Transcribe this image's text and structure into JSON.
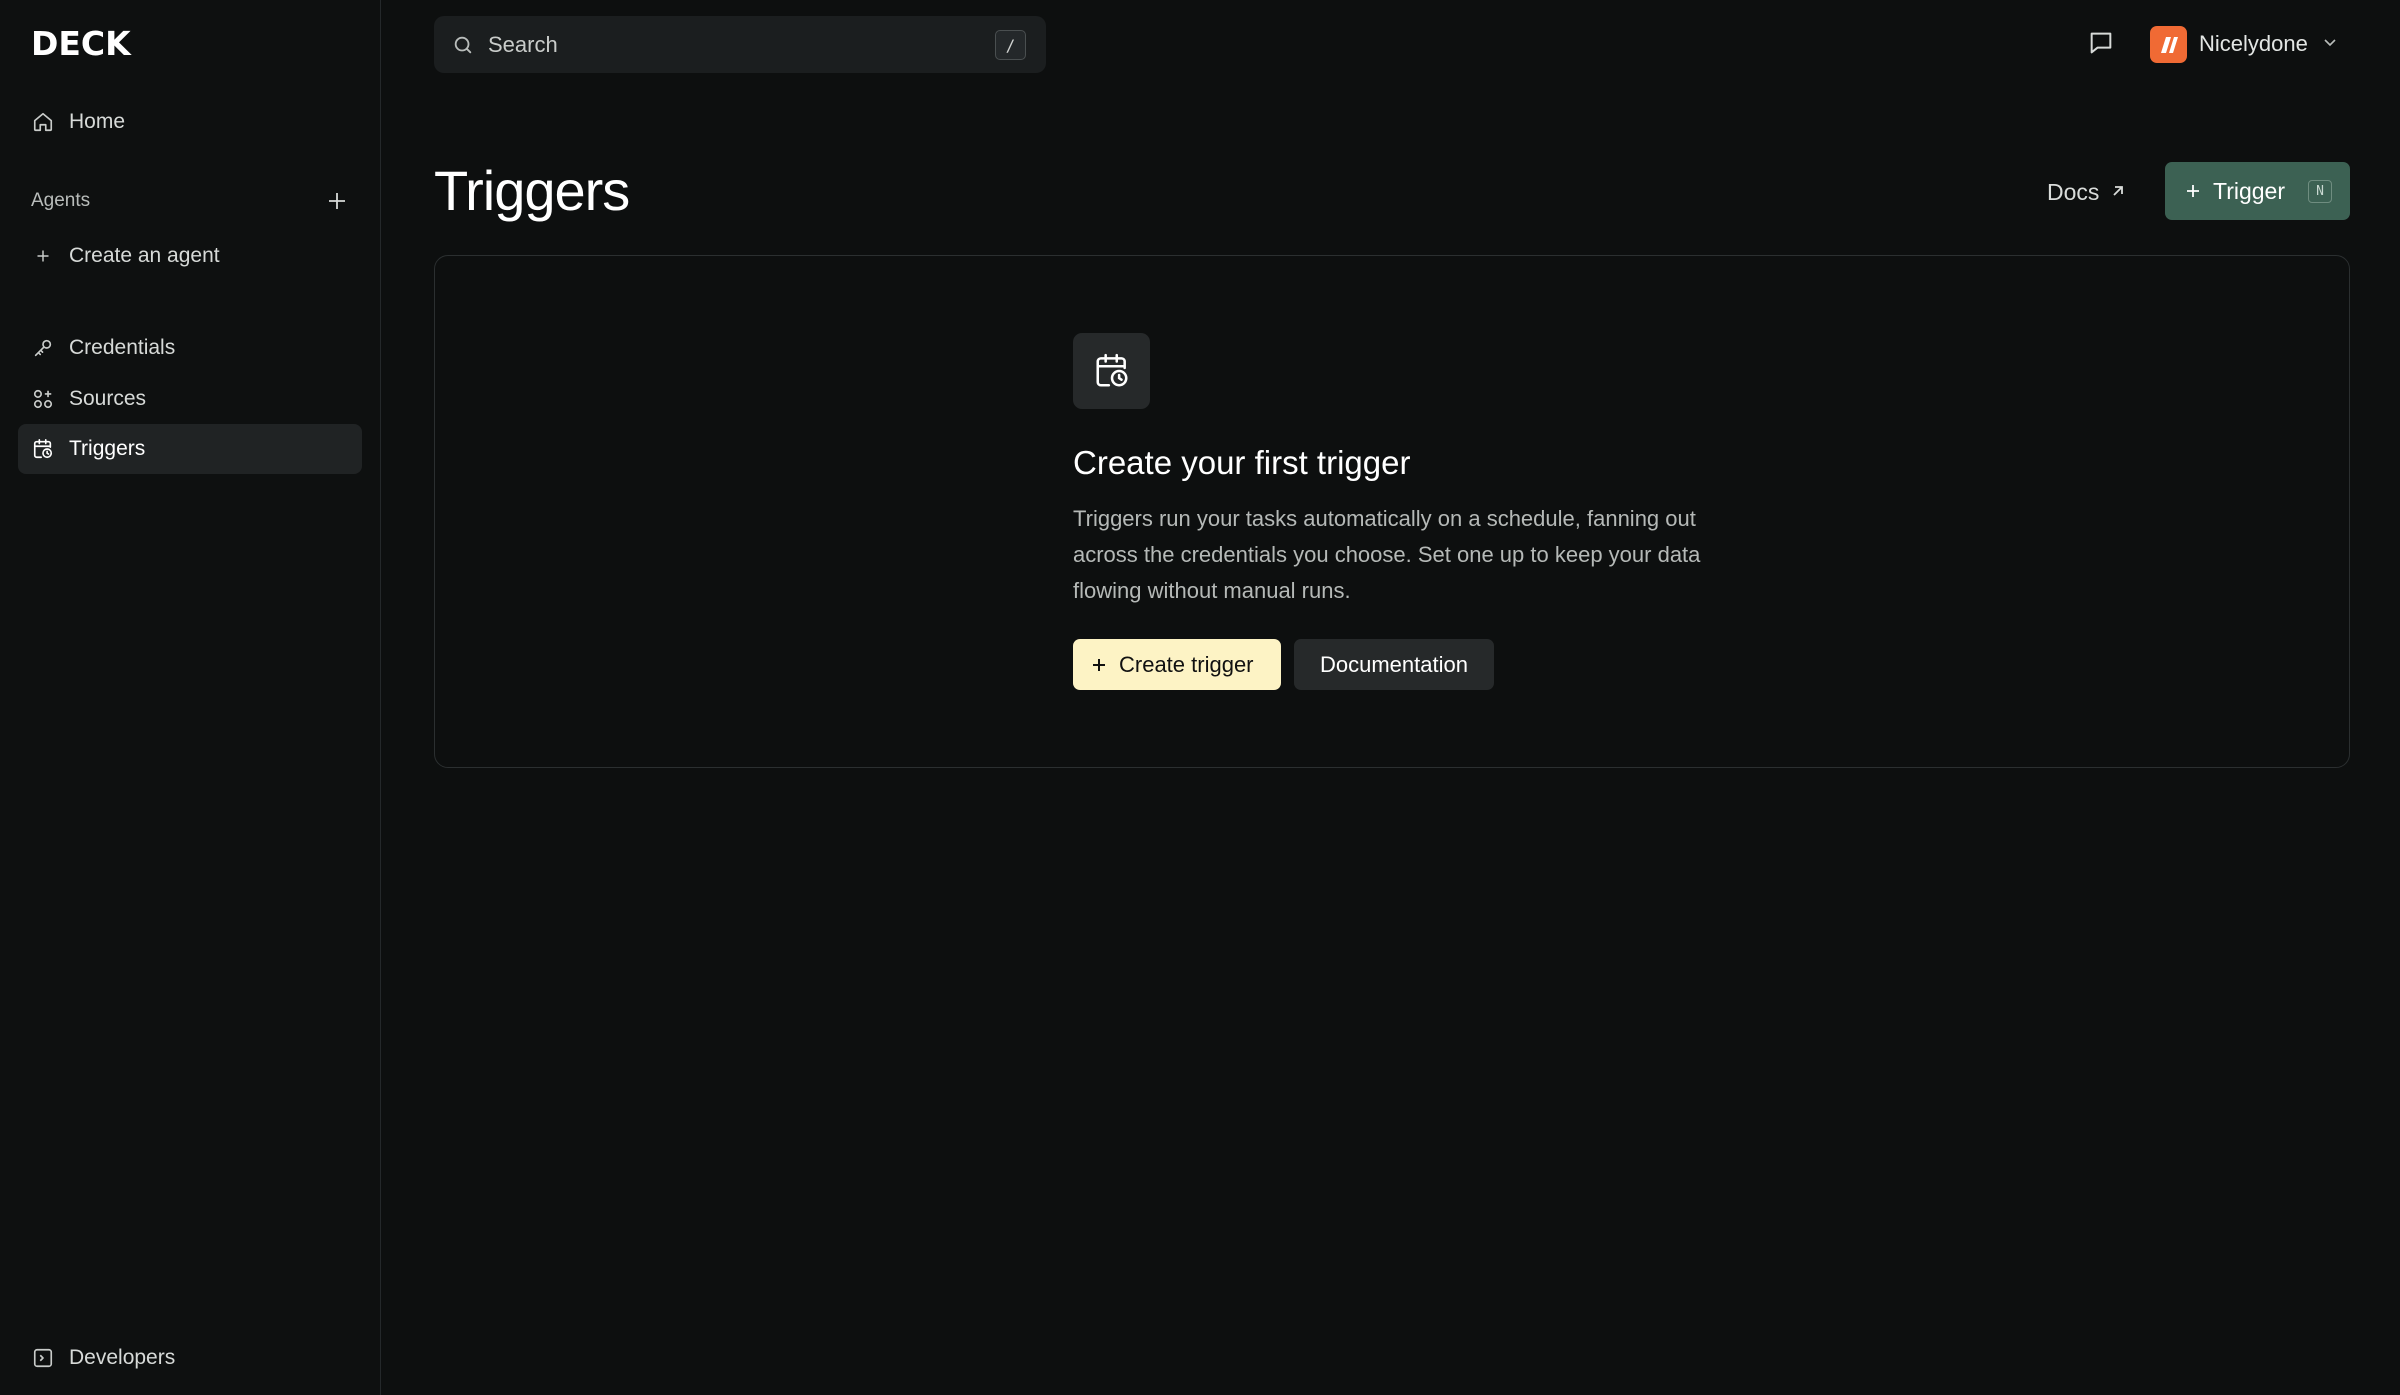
{
  "app": {
    "logo": "DECK"
  },
  "sidebar": {
    "home": {
      "label": "Home",
      "icon": "home-icon"
    },
    "agents_section": {
      "label": "Agents",
      "add_icon": "plus-icon"
    },
    "create_agent": {
      "label": "Create an agent",
      "icon": "plus-icon"
    },
    "items": [
      {
        "label": "Credentials",
        "icon": "key-icon",
        "active": false
      },
      {
        "label": "Sources",
        "icon": "grid-plus-icon",
        "active": false
      },
      {
        "label": "Triggers",
        "icon": "calendar-clock-icon",
        "active": true
      }
    ],
    "developers": {
      "label": "Developers",
      "icon": "terminal-icon"
    }
  },
  "topbar": {
    "search": {
      "placeholder": "Search",
      "shortcut": "/"
    },
    "chat_icon": "message-square-icon",
    "org": {
      "name": "Nicelydone",
      "avatar_color": "#f06a34"
    }
  },
  "header": {
    "title": "Triggers",
    "docs_label": "Docs",
    "new_button": {
      "label": "Trigger",
      "shortcut": "N"
    }
  },
  "empty_state": {
    "icon": "calendar-clock-icon",
    "title": "Create your first trigger",
    "description": "Triggers run your tasks automatically on a schedule, fanning out across the credentials you choose. Set one up to keep your data flowing without manual runs.",
    "primary_label": "Create trigger",
    "secondary_label": "Documentation"
  },
  "colors": {
    "background": "#0d0f0f",
    "sidebar_active": "#202324",
    "primary_button": "#3c6153",
    "accent_light": "#fdf3c5"
  }
}
